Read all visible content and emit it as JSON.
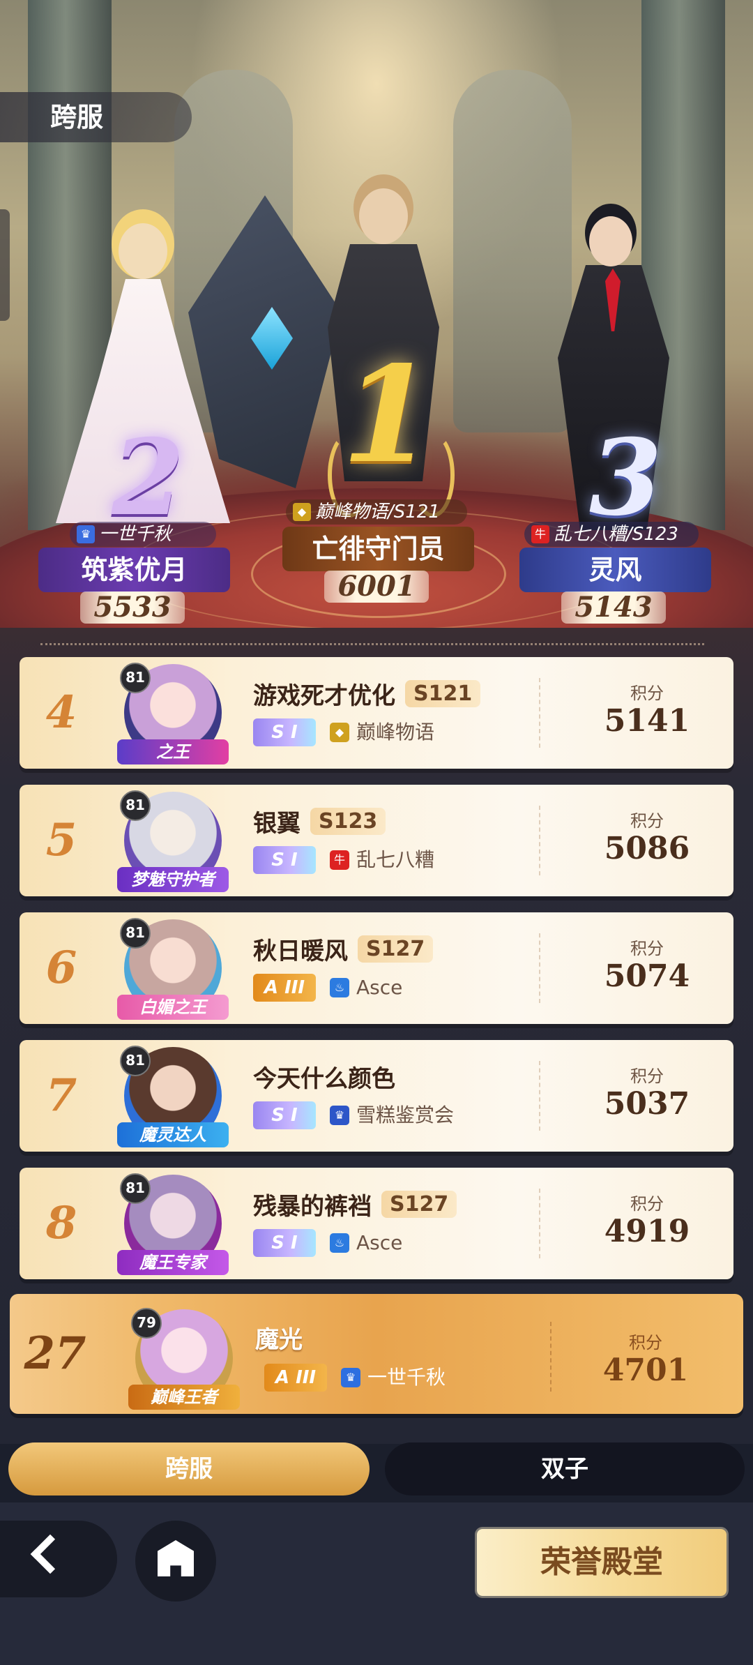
{
  "header": {
    "mode_label": "跨服"
  },
  "podium": [
    {
      "rank": "2",
      "guild": "一世千秋",
      "guild_icon": "crown-icon",
      "name": "筑紫优月",
      "score": "5533"
    },
    {
      "rank": "1",
      "guild": "巅峰物语/S121",
      "guild_icon": "diamond-icon",
      "name": "亡徘守门员",
      "score": "6001"
    },
    {
      "rank": "3",
      "guild": "乱七八糟/S123",
      "guild_icon": "cow-icon",
      "guild_icon_text": "牛",
      "name": "灵风",
      "score": "5143"
    }
  ],
  "score_label": "积分",
  "rows": [
    {
      "rank": "4",
      "level": "81",
      "title": "之王",
      "name": "游戏死才优化",
      "server": "S121",
      "tier": "S I",
      "guild": "巅峰物语",
      "guild_icon": "diamond-icon",
      "score": "5141"
    },
    {
      "rank": "5",
      "level": "81",
      "title": "梦魅守护者",
      "name": "银翼",
      "server": "S123",
      "tier": "S I",
      "guild": "乱七八糟",
      "guild_icon": "cow-icon",
      "guild_icon_text": "牛",
      "score": "5086"
    },
    {
      "rank": "6",
      "level": "81",
      "title": "白媚之王",
      "name": "秋日暖风",
      "server": "S127",
      "tier": "A III",
      "guild": "Asce",
      "guild_icon": "flame-icon",
      "score": "5074"
    },
    {
      "rank": "7",
      "level": "81",
      "title": "魔灵达人",
      "name": "今天什么颜色",
      "server": "",
      "tier": "S I",
      "guild": "雪糕鉴赏会",
      "guild_icon": "crown-icon",
      "score": "5037"
    },
    {
      "rank": "8",
      "level": "81",
      "title": "魔王专家",
      "name": "残暴的裤裆",
      "server": "S127",
      "tier": "S I",
      "guild": "Asce",
      "guild_icon": "flame-icon",
      "score": "4919"
    }
  ],
  "me": {
    "rank": "27",
    "level": "79",
    "title": "巅峰王者",
    "name": "魔光",
    "tier": "A III",
    "guild": "一世千秋",
    "guild_icon": "crown-icon",
    "score": "4701"
  },
  "tabs": [
    {
      "label": "跨服",
      "active": true
    },
    {
      "label": "双子",
      "active": false
    }
  ],
  "footer": {
    "honor_label": "荣誉殿堂"
  },
  "colors": {
    "accent": "#d69a3e",
    "rank_color": "#d58436",
    "card_bg": "#fcf0d8"
  }
}
